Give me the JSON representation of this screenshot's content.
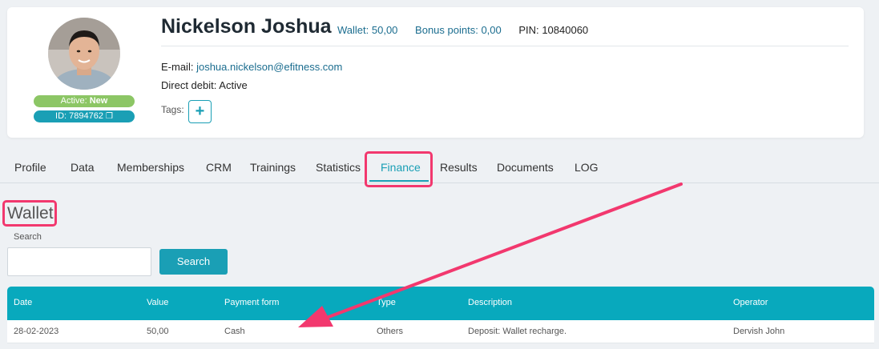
{
  "profile": {
    "name": "Nickelson Joshua",
    "wallet_label": "Wallet:",
    "wallet_value": "50,00",
    "bonus_label": "Bonus points:",
    "bonus_value": "0,00",
    "pin_label": "PIN:",
    "pin_value": "10840060",
    "status_label": "Active:",
    "status_value": "New",
    "id_label": "ID: 7894762",
    "email_label": "E-mail:",
    "email_value": "joshua.nickelson@efitness.com",
    "debit_label": "Direct debit:",
    "debit_value": "Active",
    "tags_label": "Tags:",
    "add_tag_label": "+"
  },
  "tabs": [
    {
      "label": "Profile"
    },
    {
      "label": "Data"
    },
    {
      "label": "Memberships"
    },
    {
      "label": "CRM"
    },
    {
      "label": "Trainings"
    },
    {
      "label": "Statistics"
    },
    {
      "label": "Finance",
      "active": true
    },
    {
      "label": "Results"
    },
    {
      "label": "Documents"
    },
    {
      "label": "LOG"
    }
  ],
  "wallet": {
    "title": "Wallet",
    "search_label": "Search",
    "search_value": "",
    "search_button": "Search",
    "columns": [
      "Date",
      "Value",
      "Payment form",
      "Type",
      "Description",
      "Operator"
    ],
    "rows": [
      [
        "28-02-2023",
        "50,00",
        "Cash",
        "Others",
        "Deposit: Wallet recharge.",
        "Dervish John"
      ]
    ]
  },
  "colors": {
    "accent": "#1a9fb5",
    "highlight": "#f2386e",
    "status_green": "#8cc665"
  }
}
